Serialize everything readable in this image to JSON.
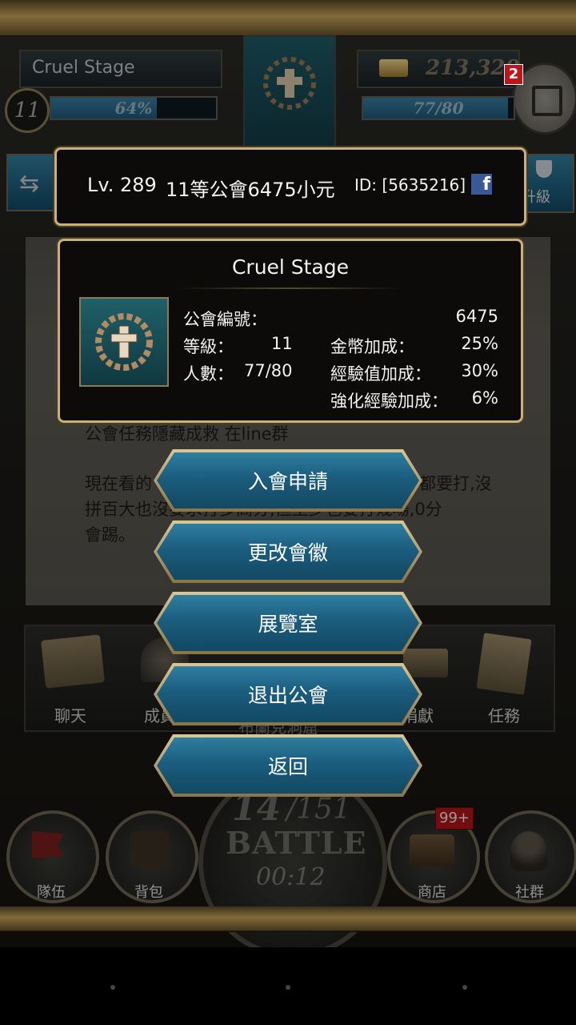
{
  "top_bar": {
    "guild_name": "Cruel Stage",
    "level_badge": "11",
    "level_progress_text": "64%",
    "level_progress": 0.64,
    "gold": "213,320",
    "notification_count": "2",
    "member_progress_text": "77/80",
    "member_progress": 0.9625,
    "upgrade_label": "升級"
  },
  "info_bar": {
    "level": "Lv. 289",
    "guild_text": "11等公會6475小元",
    "id_text": "ID: [5635216]"
  },
  "guild_card": {
    "title": "Cruel Stage",
    "guild_number_label": "公會編號：",
    "guild_number_value": "6475",
    "level_label": "等級：",
    "level_value": "11",
    "members_label": "人數：",
    "members_value": "77/80",
    "gold_bonus_label": "金幣加成：",
    "gold_bonus_value": "25%",
    "exp_bonus_label": "經驗值加成：",
    "exp_bonus_value": "30%",
    "enhance_exp_label": "強化經驗加成：",
    "enhance_exp_value": "6%"
  },
  "notice": {
    "line1": "公會任務隱藏成救 在line群",
    "line2a": "現在看的",
    "line2b": "都要打,沒",
    "line3": "拼百大也沒要求打多高分,但至少也要打幾場,0分",
    "line4": "會踢。",
    "behind_text": "布蘭克洞窟"
  },
  "menu": {
    "apply": "入會申請",
    "change_emblem": "更改會徽",
    "exhibition": "展覽室",
    "quit_guild": "退出公會",
    "back": "返回"
  },
  "guild_tabs": {
    "chat": "聊天",
    "members": "成員",
    "donate": "捐獻",
    "mission": "任務"
  },
  "battle": {
    "count": "14",
    "total": "/151",
    "label": "BATTLE",
    "timer": "00:12"
  },
  "bottom_nav": {
    "team": "隊伍",
    "bag": "背包",
    "shop": "商店",
    "shop_badge": "99+",
    "social": "社群"
  },
  "colors": {
    "accent_teal": "#1b5d7e",
    "gold_frame": "#c7a45a",
    "badge_red": "#c0141a",
    "facebook_blue": "#3b5998"
  }
}
